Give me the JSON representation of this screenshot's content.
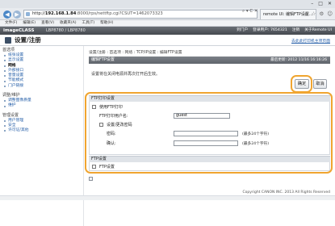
{
  "browser": {
    "window_controls": [
      "–",
      "□",
      "✕"
    ],
    "address_host": "192.168.1.84",
    "address_path": ":8000/rps/nettftp.cgi?CSUT=1462073323",
    "address_tools": "⌕ ▾ C ✕",
    "tab_label": "remote UI: 编辑FTP设置...",
    "toolbar_icons": [
      "⌂",
      "☆",
      "⚙",
      "☺"
    ],
    "menu": [
      "文件(F)",
      "编辑(E)",
      "查看(V)",
      "收藏夹(A)",
      "工具(T)",
      "帮助(H)"
    ]
  },
  "app": {
    "brand": "imageCLASS",
    "model": "LBP8780 / LBP8780",
    "header_links": [
      "到门户",
      "登录用户: 7654321",
      "注销",
      "关于Remote UI"
    ],
    "page_title": "设置/注册",
    "main_link": "去此此打印机主项页面"
  },
  "sidebar": {
    "sections": [
      {
        "title": "首选项",
        "items": [
          {
            "label": "纸张设置",
            "active": false
          },
          {
            "label": "显示设置",
            "active": false
          },
          {
            "label": "网络",
            "active": true
          },
          {
            "label": "外部接口",
            "active": false
          },
          {
            "label": "音量设置",
            "active": false
          },
          {
            "label": "节能模式",
            "active": false
          },
          {
            "label": "门户链接",
            "active": false
          }
        ]
      },
      {
        "title": "调整/维护",
        "items": [
          {
            "label": "调整图像质量",
            "active": false
          },
          {
            "label": "维护",
            "active": false
          }
        ]
      },
      {
        "title": "管理设置",
        "items": [
          {
            "label": "用户管理",
            "active": false
          },
          {
            "label": "安全",
            "active": false
          },
          {
            "label": "许可证/其他",
            "active": false
          }
        ]
      }
    ]
  },
  "main": {
    "breadcrumb": "设置/注册 : 首选项 : 网络 : TCP/IP设置 : 编辑FTP设置",
    "section_title": "编辑FTP设置",
    "last_updated": "最后更新: 2012 11/16 16:16:26",
    "notice": "设置将在关闭电源并再次打开后生效。",
    "ok_label": "确定",
    "cancel_label": "取消",
    "ftp_print": {
      "title": "FTP打印设置",
      "enable_label": "使用FTP打印",
      "username_label": "FTP打印用户名:",
      "username_value": "guest",
      "set_password_label": "设置/更改密码",
      "password_label": "密码:",
      "password_hint": "(最多24个字符)",
      "confirm_label": "确认:",
      "confirm_hint": "(最多24个字符)"
    },
    "ftp_pasv": {
      "title": "FTP设置",
      "option_label": "FTP设置"
    }
  },
  "footer": "Copyright CANON INC. 2013 All Rights Reserved"
}
